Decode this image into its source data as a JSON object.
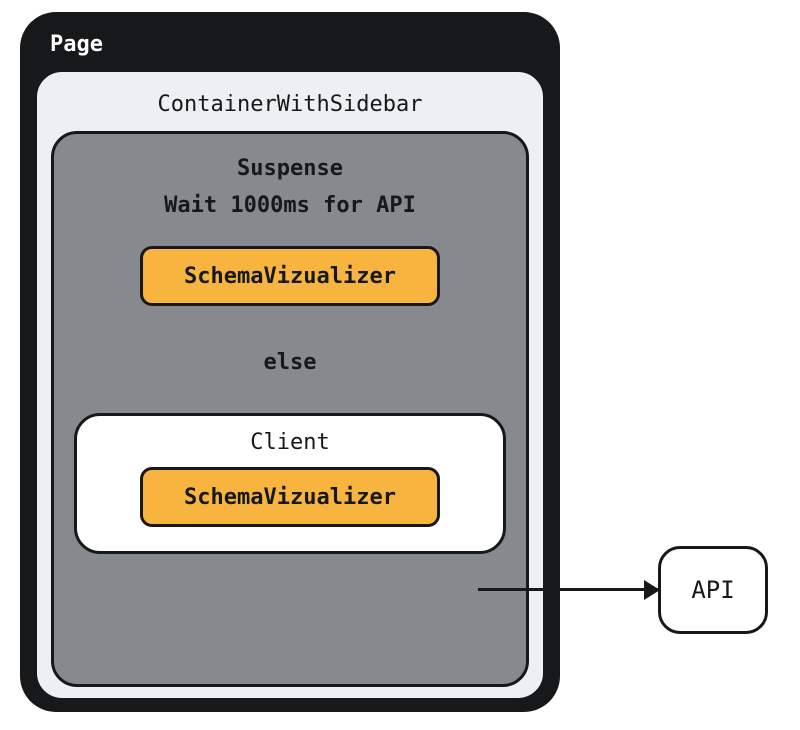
{
  "page": {
    "title": "Page"
  },
  "container": {
    "title": "ContainerWithSidebar"
  },
  "suspense": {
    "title": "Suspense",
    "wait_label": "Wait 1000ms for API",
    "component_label": "SchemaVizualizer",
    "else_label": "else"
  },
  "client": {
    "title": "Client",
    "component_label": "SchemaVizualizer"
  },
  "api": {
    "label": "API"
  }
}
